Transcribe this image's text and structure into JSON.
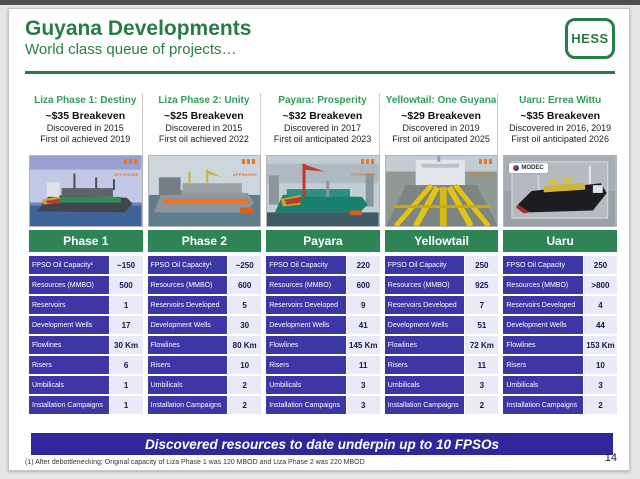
{
  "header": {
    "title": "Guyana Developments",
    "subtitle": "World class queue of projects…",
    "logo_text": "HESS"
  },
  "footer": {
    "banner": "Discovered resources to date underpin up to 10 FPSOs",
    "footnote": "(1) After debottlenecking; Original capacity of Liza Phase 1 was 120 MBOD and Liza Phase 2 was 220 MBOD",
    "page_number": "14"
  },
  "colors": {
    "hess_green": "#287d46",
    "project_title_green": "#2f9e5b",
    "table_header_green": "#2e8455",
    "table_label_indigo": "#3d37a6",
    "value_cell_bg": "#e9e9f7",
    "value_text": "#15154d",
    "bottom_banner_indigo": "#2f279c",
    "sbm_orange": "#e87722"
  },
  "projects": [
    {
      "title": "Liza Phase 1: Destiny",
      "breakeven": "~$35 Breakeven",
      "discovered": "Discovered in 2015",
      "first_oil": "First oil achieved 2019",
      "table_header": "Phase 1",
      "vendor": "SBM Offshore",
      "vendor_label": "OFFSHORE",
      "vendor_style": "sbm",
      "photo_variant": "ship-sea-1",
      "rows": [
        {
          "label": "FPSO Oil Capacity¹",
          "value": "~150"
        },
        {
          "label": "Resources (MMBO)",
          "value": "500"
        },
        {
          "label": "Reservoirs",
          "value": "1"
        },
        {
          "label": "Development Wells",
          "value": "17"
        },
        {
          "label": "Flowlines",
          "value": "30 Km"
        },
        {
          "label": "Risers",
          "value": "6"
        },
        {
          "label": "Umbilicals",
          "value": "1"
        },
        {
          "label": "Installation Campaigns",
          "value": "1"
        }
      ]
    },
    {
      "title": "Liza Phase 2: Unity",
      "breakeven": "~$25 Breakeven",
      "discovered": "Discovered in 2015",
      "first_oil": "First oil achieved 2022",
      "table_header": "Phase 2",
      "vendor": "SBM Offshore",
      "vendor_label": "OFFSHORE",
      "vendor_style": "sbm",
      "photo_variant": "ship-sea-2",
      "rows": [
        {
          "label": "FPSO Oil Capacity¹",
          "value": "~250"
        },
        {
          "label": "Resources (MMBO)",
          "value": "600"
        },
        {
          "label": "Reservoirs Developed",
          "value": "5"
        },
        {
          "label": "Development Wells",
          "value": "30"
        },
        {
          "label": "Flowlines",
          "value": "80 Km"
        },
        {
          "label": "Risers",
          "value": "10"
        },
        {
          "label": "Umbilicals",
          "value": "2"
        },
        {
          "label": "Installation Campaigns",
          "value": "2"
        }
      ]
    },
    {
      "title": "Payara: Prosperity",
      "breakeven": "~$32 Breakeven",
      "discovered": "Discovered in 2017",
      "first_oil": "First oil anticipated 2023",
      "table_header": "Payara",
      "vendor": "SBM Offshore",
      "vendor_label": "OFFSHORE",
      "vendor_style": "sbm",
      "photo_variant": "ship-dock",
      "rows": [
        {
          "label": "FPSO Oil Capacity",
          "value": "220"
        },
        {
          "label": "Resources (MMBO)",
          "value": "600"
        },
        {
          "label": "Reservoirs Developed",
          "value": "9"
        },
        {
          "label": "Development Wells",
          "value": "41"
        },
        {
          "label": "Flowlines",
          "value": "145 Km"
        },
        {
          "label": "Risers",
          "value": "11"
        },
        {
          "label": "Umbilicals",
          "value": "3"
        },
        {
          "label": "Installation Campaigns",
          "value": "3"
        }
      ]
    },
    {
      "title": "Yellowtail: One Guyana",
      "breakeven": "~$29 Breakeven",
      "discovered": "Discovered in 2019",
      "first_oil": "First oil anticipated 2025",
      "table_header": "Yellowtail",
      "vendor": "SBM Offshore",
      "vendor_label": "OFFSHORE",
      "vendor_style": "sbm",
      "photo_variant": "deck-pipes",
      "rows": [
        {
          "label": "FPSO Oil Capacity",
          "value": "250"
        },
        {
          "label": "Resources (MMBO)",
          "value": "925"
        },
        {
          "label": "Reservoirs Developed",
          "value": "7"
        },
        {
          "label": "Development Wells",
          "value": "51"
        },
        {
          "label": "Flowlines",
          "value": "72 Km"
        },
        {
          "label": "Risers",
          "value": "11"
        },
        {
          "label": "Umbilicals",
          "value": "3"
        },
        {
          "label": "Installation Campaigns",
          "value": "2"
        }
      ]
    },
    {
      "title": "Uaru: Errea Wittu",
      "breakeven": "~$35 Breakeven",
      "discovered": "Discovered in 2016, 2019",
      "first_oil": "First oil anticipated 2026",
      "table_header": "Uaru",
      "vendor": "MODEC",
      "vendor_label": "MODEC",
      "vendor_style": "modec",
      "photo_variant": "render-ship",
      "rows": [
        {
          "label": "FPSO Oil Capacity",
          "value": "250"
        },
        {
          "label": "Resources (MMBO)",
          "value": ">800"
        },
        {
          "label": "Reservoirs Developed",
          "value": "4"
        },
        {
          "label": "Development Wells",
          "value": "44"
        },
        {
          "label": "Flowlines",
          "value": "153 Km"
        },
        {
          "label": "Risers",
          "value": "10"
        },
        {
          "label": "Umbilicals",
          "value": "3"
        },
        {
          "label": "Installation Campaigns",
          "value": "2"
        }
      ]
    }
  ]
}
